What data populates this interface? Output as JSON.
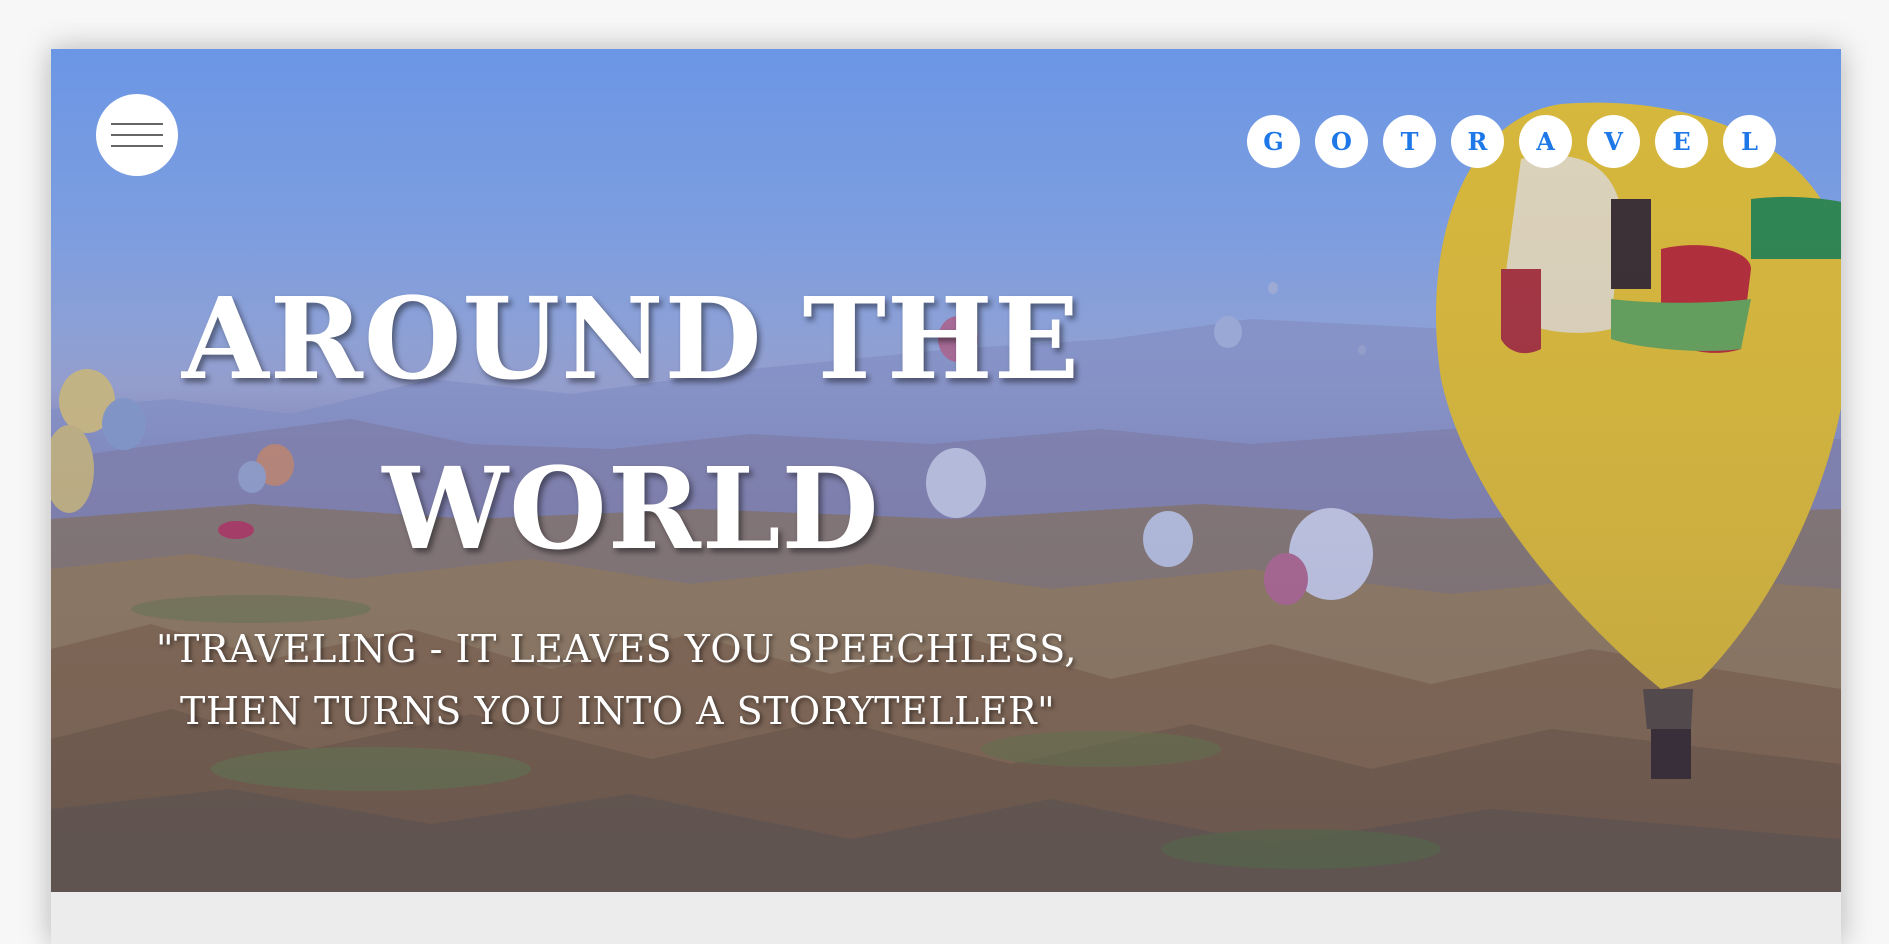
{
  "hero": {
    "headline_line1": "AROUND THE",
    "headline_line2": "WORLD",
    "quote_line1": "\"TRAVELING - IT LEAVES YOU SPEECHLESS,",
    "quote_line2": "THEN TURNS YOU INTO A STORYTELLER\""
  },
  "header": {
    "menu_icon": "hamburger-menu-icon",
    "logo_letters": [
      "G",
      "O",
      "T",
      "R",
      "A",
      "V",
      "E",
      "L"
    ]
  },
  "colors": {
    "accent": "#1f78e8",
    "badge_bg": "#ffffff",
    "headline": "#ffffff",
    "balloon_yellow": "#e8c12a"
  }
}
